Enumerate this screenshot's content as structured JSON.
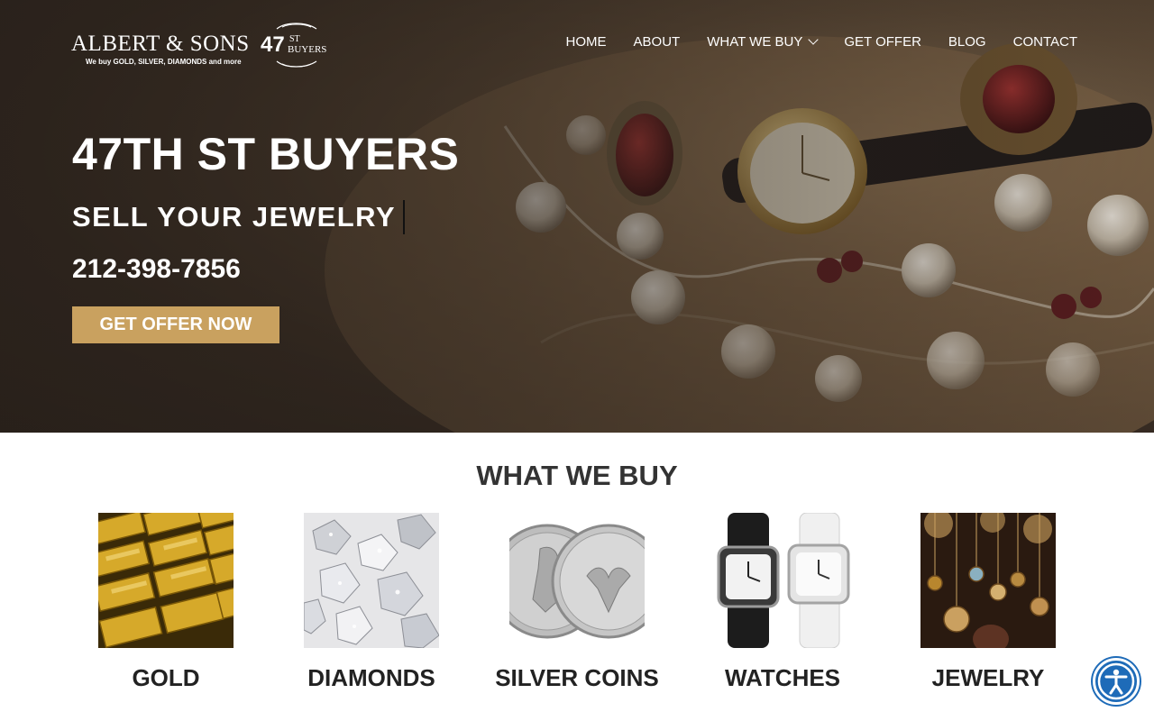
{
  "brand": {
    "name": "ALBERT & SONS",
    "badge_number": "47",
    "badge_st": "ST",
    "badge_buyers": "BUYERS",
    "tagline": "We buy GOLD, SILVER, DIAMONDS and more"
  },
  "nav": {
    "items": [
      {
        "label": "HOME"
      },
      {
        "label": "ABOUT"
      },
      {
        "label": "WHAT WE BUY",
        "has_dropdown": true
      },
      {
        "label": "GET OFFER"
      },
      {
        "label": "BLOG"
      },
      {
        "label": "CONTACT"
      }
    ]
  },
  "hero": {
    "title": "47TH ST BUYERS",
    "subtitle": "SELL YOUR JEWELRY",
    "phone": "212-398-7856",
    "cta_label": "GET OFFER NOW"
  },
  "what_we_buy": {
    "title": "WHAT WE BUY",
    "items": [
      {
        "label": "GOLD"
      },
      {
        "label": "DIAMONDS"
      },
      {
        "label": "SILVER COINS"
      },
      {
        "label": "WATCHES"
      },
      {
        "label": "JEWELRY"
      }
    ]
  },
  "colors": {
    "accent": "#c9a15f",
    "accessibility": "#1e6bb8",
    "heading": "#333333"
  },
  "icons": {
    "dropdown": "chevron-down-icon",
    "accessibility": "accessibility-icon"
  }
}
